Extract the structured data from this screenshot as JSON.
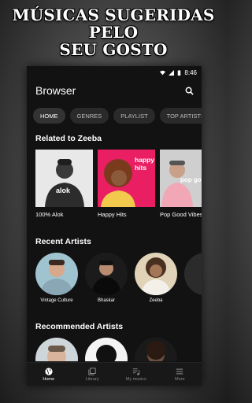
{
  "promo": {
    "line1": "MÚSICAS SUGERIDAS PELO",
    "line2": "SEU GOSTO"
  },
  "status_bar": {
    "time": "8:46"
  },
  "app_bar": {
    "title": "Browser"
  },
  "chips": [
    {
      "label": "HOME",
      "active": true
    },
    {
      "label": "GENRES",
      "active": false
    },
    {
      "label": "PLAYLIST",
      "active": false
    },
    {
      "label": "TOP ARTISTS",
      "active": false
    }
  ],
  "related": {
    "title": "Related to Zeeba",
    "cards": [
      {
        "label": "100% Alok",
        "art_text": "alok"
      },
      {
        "label": "Happy Hits",
        "art_text": "happy hits"
      },
      {
        "label": "Pop Good Vibes",
        "art_text": "pop good"
      }
    ]
  },
  "recent_artists": {
    "title": "Recent Artists",
    "items": [
      {
        "name": "Vintage Culture"
      },
      {
        "name": "Bhaskar"
      },
      {
        "name": "Zeeba"
      }
    ]
  },
  "recommended_artists": {
    "title": "Recommended Artists"
  },
  "bottom_nav": [
    {
      "label": "Home",
      "icon": "globe-icon",
      "active": true
    },
    {
      "label": "Library",
      "icon": "library-icon",
      "active": false
    },
    {
      "label": "My musics",
      "icon": "music-list-icon",
      "active": false
    },
    {
      "label": "More",
      "icon": "menu-icon",
      "active": false
    }
  ],
  "colors": {
    "background": "#121212",
    "chip": "#2a2a2a",
    "card_pink": "#e91e63"
  }
}
